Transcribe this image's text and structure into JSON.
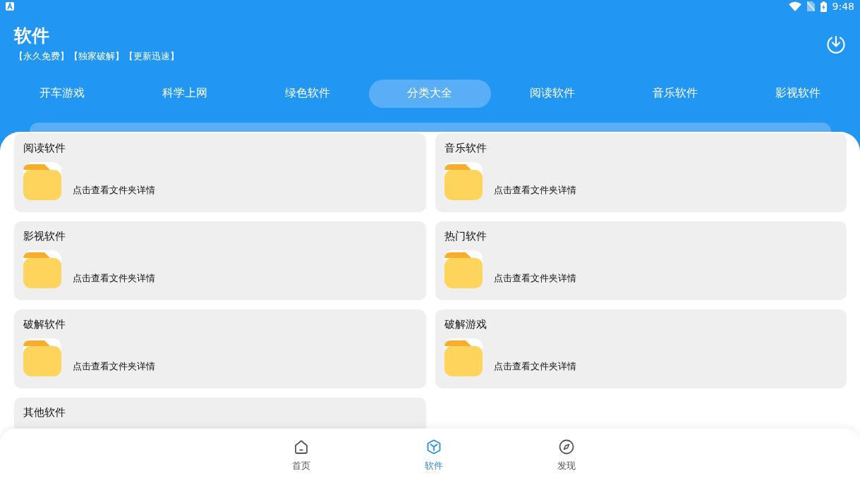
{
  "status_bar": {
    "time": "9:48"
  },
  "header": {
    "title": "软件",
    "subtitle": "【永久免费】【独家破解】【更新迅速】"
  },
  "tabs": [
    {
      "label": "开车游戏",
      "selected": false
    },
    {
      "label": "科学上网",
      "selected": false
    },
    {
      "label": "绿色软件",
      "selected": false
    },
    {
      "label": "分类大全",
      "selected": true
    },
    {
      "label": "阅读软件",
      "selected": false
    },
    {
      "label": "音乐软件",
      "selected": false
    },
    {
      "label": "影视软件",
      "selected": false
    }
  ],
  "folders": [
    {
      "name": "阅读软件",
      "detail": "点击查看文件夹详情"
    },
    {
      "name": "音乐软件",
      "detail": "点击查看文件夹详情"
    },
    {
      "name": "影视软件",
      "detail": "点击查看文件夹详情"
    },
    {
      "name": "热门软件",
      "detail": "点击查看文件夹详情"
    },
    {
      "name": "破解软件",
      "detail": "点击查看文件夹详情"
    },
    {
      "name": "破解游戏",
      "detail": "点击查看文件夹详情"
    },
    {
      "name": "其他软件"
    }
  ],
  "bottom_nav": [
    {
      "label": "首页",
      "kind": "home",
      "selected": false
    },
    {
      "label": "软件",
      "kind": "cube",
      "selected": true
    },
    {
      "label": "发现",
      "kind": "compass",
      "selected": false
    }
  ]
}
